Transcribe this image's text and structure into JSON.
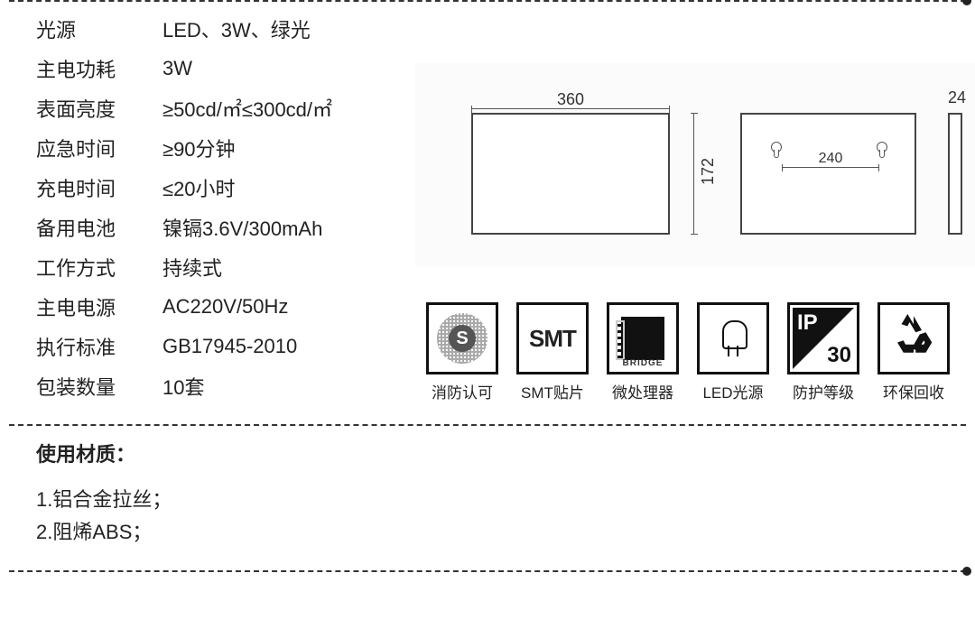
{
  "specs": {
    "rows": [
      {
        "label": "光源",
        "value": "LED、3W、绿光"
      },
      {
        "label": "主电功耗",
        "value": "3W"
      },
      {
        "label": "表面亮度",
        "value": "≥50cd/㎡≤300cd/㎡"
      },
      {
        "label": "应急时间",
        "value": "≥90分钟"
      },
      {
        "label": "充电时间",
        "value": "≤20小时"
      },
      {
        "label": "备用电池",
        "value": "镍镉3.6V/300mAh"
      },
      {
        "label": "工作方式",
        "value": "持续式"
      },
      {
        "label": "主电电源",
        "value": "AC220V/50Hz"
      },
      {
        "label": "执行标准",
        "value": "GB17945-2010"
      },
      {
        "label": "包装数量",
        "value": "10套"
      }
    ]
  },
  "dimensions": {
    "width": "360",
    "height": "172",
    "mount_spacing": "240",
    "depth": "24"
  },
  "certifications": [
    {
      "key": "fire",
      "label": "消防认可",
      "icon_text": "S"
    },
    {
      "key": "smt",
      "label": "SMT贴片",
      "icon_text": "SMT"
    },
    {
      "key": "bridge",
      "label": "微处理器",
      "icon_text": "BRIDGE"
    },
    {
      "key": "led",
      "label": "LED光源",
      "icon_text": ""
    },
    {
      "key": "ip",
      "label": "防护等级",
      "icon_text": "IP",
      "icon_num": "30"
    },
    {
      "key": "recycle",
      "label": "环保回收",
      "icon_text": ""
    }
  ],
  "materials": {
    "title": "使用材质：",
    "items": [
      "1.铝合金拉丝；",
      "2.阻烯ABS；"
    ]
  }
}
